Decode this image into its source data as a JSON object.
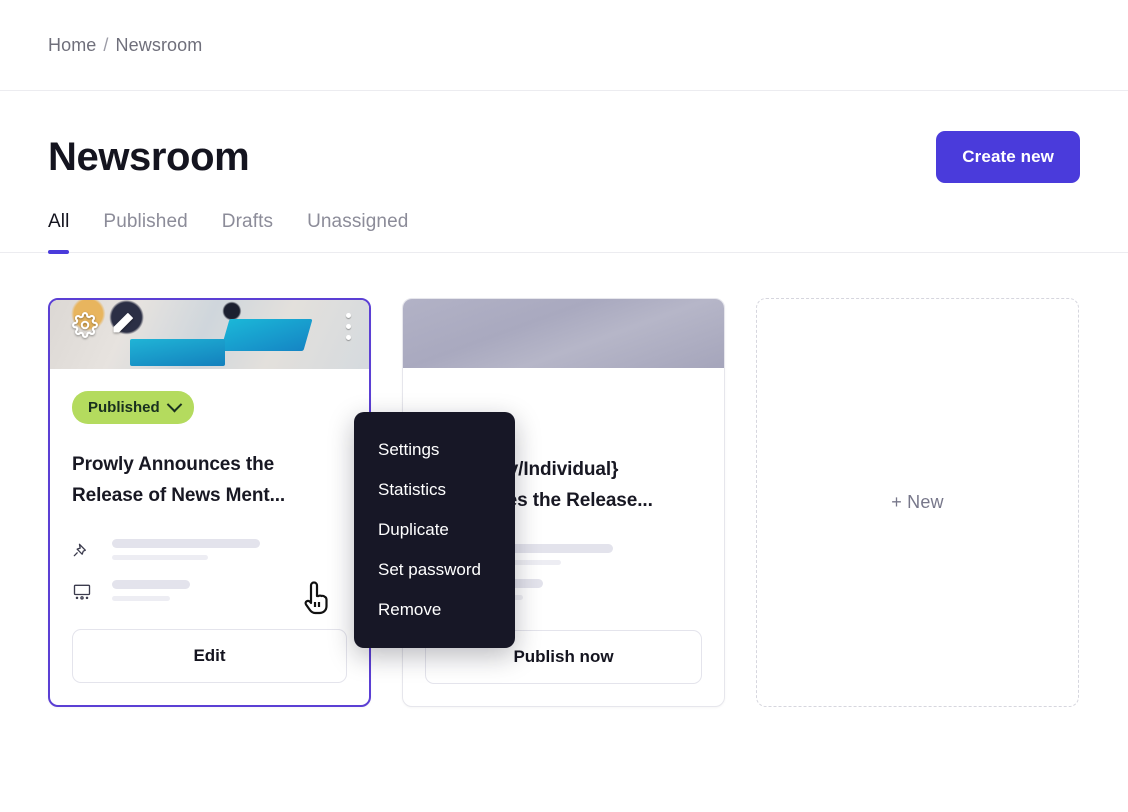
{
  "breadcrumb": {
    "home": "Home",
    "separator": "/",
    "current": "Newsroom"
  },
  "header": {
    "title": "Newsroom",
    "create_button": "Create new"
  },
  "tabs": [
    {
      "label": "All",
      "active": true
    },
    {
      "label": "Published",
      "active": false
    },
    {
      "label": "Drafts",
      "active": false
    },
    {
      "label": "Unassigned",
      "active": false
    }
  ],
  "cards": [
    {
      "selected": true,
      "status": "Published",
      "title": "Prowly Announces the Release of News Ment...",
      "action_label": "Edit",
      "thumbnail": "desk-photo",
      "thumb_icons": [
        "gear-icon",
        "pencil-icon",
        "kebab-menu-icon"
      ]
    },
    {
      "selected": false,
      "status": "",
      "title": "{Company/Individual} Announces the Release...",
      "action_label": "Publish now",
      "thumbnail": "gray-gradient",
      "thumb_icons": []
    }
  ],
  "new_card": {
    "label": "+ New"
  },
  "dropdown": {
    "items": [
      "Settings",
      "Statistics",
      "Duplicate",
      "Set password",
      "Remove"
    ]
  },
  "colors": {
    "accent": "#4a3bdb",
    "selected_border": "#5b3fd4",
    "badge_published": "#b4db5e",
    "menu_background": "#171726",
    "text_primary": "#14141f",
    "text_muted": "#8c8c99"
  },
  "cursor": {
    "type": "pointing-hand"
  }
}
